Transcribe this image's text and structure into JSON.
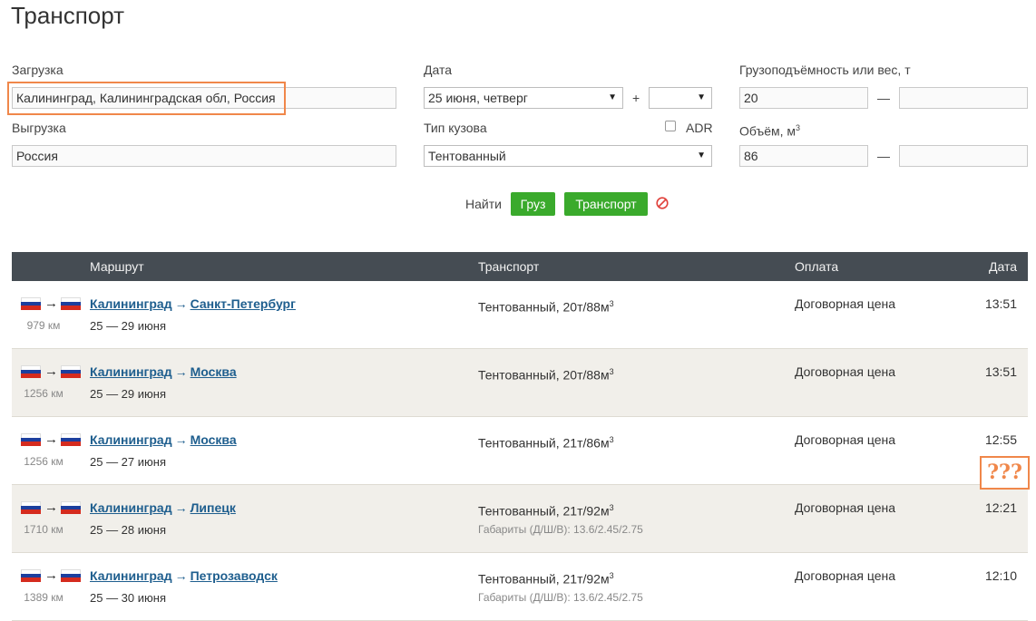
{
  "page": {
    "title": "Транспорт"
  },
  "form": {
    "loading": {
      "label": "Загрузка",
      "value": "Калининград, Калининградская обл, Россия"
    },
    "unloading": {
      "label": "Выгрузка",
      "value": "Россия"
    },
    "date": {
      "label": "Дата",
      "value": "25 июня, четверг",
      "plus": "+",
      "extra_value": ""
    },
    "body_type": {
      "label": "Тип кузова",
      "value": "Тентованный",
      "adr_label": "ADR",
      "adr_checked": false
    },
    "capacity": {
      "label": "Грузоподъёмность или вес, т",
      "from": "20",
      "dash": "—",
      "to": ""
    },
    "volume": {
      "label_text": "Объём, м",
      "label_sup": "3",
      "from": "86",
      "dash": "—",
      "to": ""
    },
    "find_label": "Найти",
    "cargo_button": "Груз",
    "transport_button": "Транспорт"
  },
  "table": {
    "headers": {
      "route": "Маршрут",
      "transport": "Транспорт",
      "payment": "Оплата",
      "date": "Дата"
    },
    "rows": [
      {
        "from": "Калининград",
        "arrow": "→",
        "to": "Санкт-Петербург",
        "km": "979 км",
        "dates": "25 — 29 июня",
        "transport": "Тентованный, 20т/88м",
        "sup": "3",
        "dims": "",
        "payment": "Договорная цена",
        "time": "13:51"
      },
      {
        "from": "Калининград",
        "arrow": "→",
        "to": "Москва",
        "km": "1256 км",
        "dates": "25 — 29 июня",
        "transport": "Тентованный, 20т/88м",
        "sup": "3",
        "dims": "",
        "payment": "Договорная цена",
        "time": "13:51"
      },
      {
        "from": "Калининград",
        "arrow": "→",
        "to": "Москва",
        "km": "1256 км",
        "dates": "25 — 27 июня",
        "transport": "Тентованный, 21т/86м",
        "sup": "3",
        "dims": "",
        "payment": "Договорная цена",
        "time": "12:55"
      },
      {
        "from": "Калининград",
        "arrow": "→",
        "to": "Липецк",
        "km": "1710 км",
        "dates": "25 — 28 июня",
        "transport": "Тентованный, 21т/92м",
        "sup": "3",
        "dims": "Габариты (Д/Ш/В): 13.6/2.45/2.75",
        "payment": "Договорная цена",
        "time": "12:21"
      },
      {
        "from": "Калининград",
        "arrow": "→",
        "to": "Петрозаводск",
        "km": "1389 км",
        "dates": "25 — 30 июня",
        "transport": "Тентованный, 21т/92м",
        "sup": "3",
        "dims": "Габариты (Д/Ш/В): 13.6/2.45/2.75",
        "payment": "Договорная цена",
        "time": "12:10"
      }
    ],
    "flag_colors": [
      "#ffffff",
      "#1c3f9e",
      "#d52b1e"
    ],
    "route_arrow": "→"
  },
  "annotation": {
    "text": "???",
    "color": "#f0874a"
  },
  "colors": {
    "header_bg": "#454c53",
    "button_green": "#3aaa2c",
    "link": "#1e5e8e",
    "alt_row": "#f1efea"
  }
}
